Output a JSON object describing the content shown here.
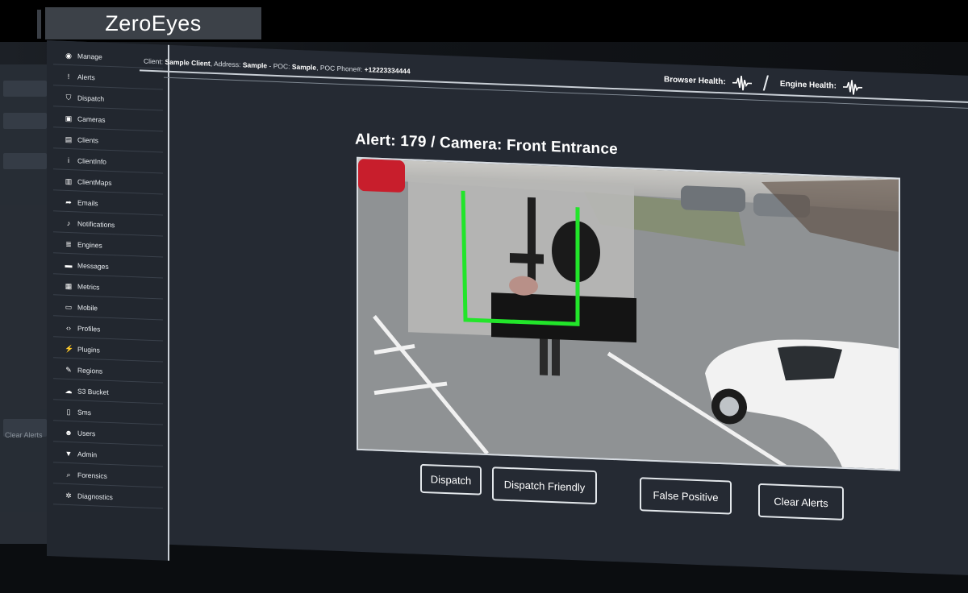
{
  "brand": {
    "name": "ZeroEyes"
  },
  "left_glimpse": {
    "ghost_label": "Clear Alerts"
  },
  "header": {
    "client_label": "Client:",
    "client_value": "Sample Client",
    "address_label": "Address:",
    "address_value": "Sample",
    "poc_label": "POC:",
    "poc_value": "Sample",
    "phone_label": "POC Phone#:",
    "phone_value": "+12223334444",
    "browser_health": "Browser Health:",
    "engine_health": "Engine Health:",
    "slash": "/"
  },
  "sidebar": {
    "items": [
      {
        "label": "Manage",
        "icon": "eye-icon",
        "glyph": "◉"
      },
      {
        "label": "Alerts",
        "icon": "alert-icon",
        "glyph": "!"
      },
      {
        "label": "Dispatch",
        "icon": "shield-icon",
        "glyph": "⛉"
      },
      {
        "label": "Cameras",
        "icon": "camera-icon",
        "glyph": "▣"
      },
      {
        "label": "Clients",
        "icon": "id-card-icon",
        "glyph": "▤"
      },
      {
        "label": "ClientInfo",
        "icon": "info-icon",
        "glyph": "i"
      },
      {
        "label": "ClientMaps",
        "icon": "map-icon",
        "glyph": "▥"
      },
      {
        "label": "Emails",
        "icon": "share-icon",
        "glyph": "➦"
      },
      {
        "label": "Notifications",
        "icon": "bell-icon",
        "glyph": "♪"
      },
      {
        "label": "Engines",
        "icon": "list-icon",
        "glyph": "≣"
      },
      {
        "label": "Messages",
        "icon": "message-icon",
        "glyph": "▬"
      },
      {
        "label": "Metrics",
        "icon": "calculator-icon",
        "glyph": "▦"
      },
      {
        "label": "Mobile",
        "icon": "mobile-icon",
        "glyph": "▭"
      },
      {
        "label": "Profiles",
        "icon": "code-icon",
        "glyph": "‹›"
      },
      {
        "label": "Plugins",
        "icon": "plug-icon",
        "glyph": "⚡"
      },
      {
        "label": "Regions",
        "icon": "pencil-icon",
        "glyph": "✎"
      },
      {
        "label": "S3 Bucket",
        "icon": "cloud-icon",
        "glyph": "☁"
      },
      {
        "label": "Sms",
        "icon": "phone-icon",
        "glyph": "▯"
      },
      {
        "label": "Users",
        "icon": "user-icon",
        "glyph": "☻"
      },
      {
        "label": "Admin",
        "icon": "bookmark-icon",
        "glyph": "▼"
      },
      {
        "label": "Forensics",
        "icon": "search-icon",
        "glyph": "⌕"
      },
      {
        "label": "Diagnostics",
        "icon": "bug-icon",
        "glyph": "✲"
      }
    ]
  },
  "alert": {
    "title": "Alert: 179 / Camera: Front Entrance"
  },
  "actions": {
    "dispatch": "Dispatch",
    "dispatch_friendly": "Dispatch Friendly",
    "false_positive": "False Positive",
    "clear_alerts": "Clear Alerts"
  },
  "colors": {
    "detection_box": "#22e52a",
    "panel_bg": "#252a33",
    "brand_bg": "#3c4148"
  }
}
